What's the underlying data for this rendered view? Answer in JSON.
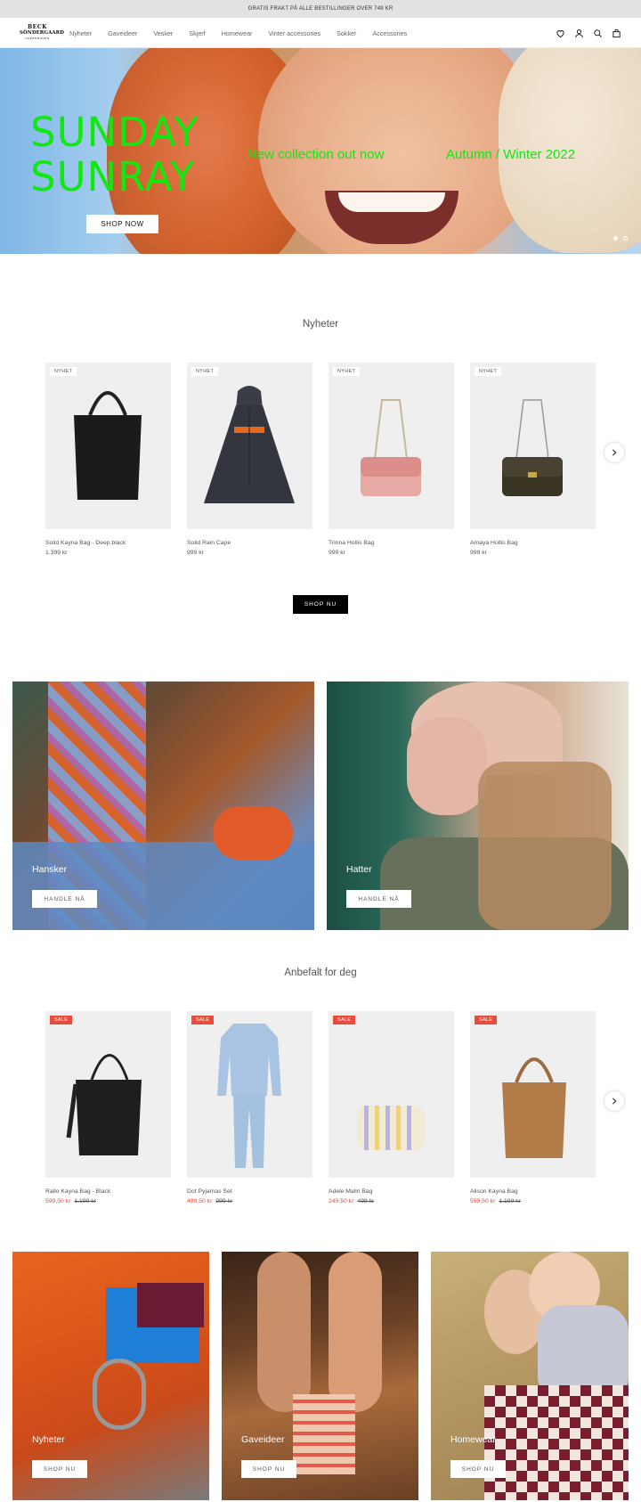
{
  "announcement": "GRATIS FRAKT PÅ ALLE BESTILLINGER OVER 749 KR",
  "logo": {
    "line1": "BECK",
    "line2": "SÖNDERGAARD",
    "line3": "COPENHAGEN"
  },
  "nav": [
    "Nyheter",
    "Gaveideer",
    "Vesker",
    "Skjerf",
    "Homewear",
    "Vinter accessories",
    "Sokker",
    "Accessories"
  ],
  "header_icons": [
    "heart-icon",
    "user-icon",
    "search-icon",
    "bag-icon"
  ],
  "hero": {
    "title_line1": "SUNDAY",
    "title_line2": "SUNRAY",
    "tagline1": "New collection out now",
    "tagline2": "Autumn / Winter 2022",
    "button": "SHOP NOW",
    "slide_count": 2,
    "active_slide": 1
  },
  "colors": {
    "accent_green": "#10e810",
    "sale_red": "#e74c3c"
  },
  "new_section": {
    "title": "Nyheter",
    "products": [
      {
        "badge": "NYHET",
        "name": "Solid Kayna Bag - Deep black",
        "price": "1.399 kr"
      },
      {
        "badge": "NYHET",
        "name": "Solid Rain Cape",
        "price": "999 kr"
      },
      {
        "badge": "NYHET",
        "name": "Trinna Hollis Bag",
        "price": "999 kr"
      },
      {
        "badge": "NYHET",
        "name": "Amaya Hollis Bag",
        "price": "999 kr"
      }
    ],
    "button": "SHOP NU"
  },
  "category_tiles": [
    {
      "label": "Hansker",
      "button": "HANDLE NÅ"
    },
    {
      "label": "Hatter",
      "button": "HANDLE NÅ"
    }
  ],
  "recommended_section": {
    "title": "Anbefalt for deg",
    "products": [
      {
        "badge": "SALE",
        "name": "Rallo Kayna Bag - Black",
        "sale_price": "599,50 kr",
        "old_price": "1.199 kr"
      },
      {
        "badge": "SALE",
        "name": "Dot Pyjamas Set",
        "sale_price": "499,50 kr",
        "old_price": "999 kr"
      },
      {
        "badge": "SALE",
        "name": "Adele Malin Bag",
        "sale_price": "249,50 kr",
        "old_price": "499 kr"
      },
      {
        "badge": "SALE",
        "name": "Alison Kayna Bag",
        "sale_price": "599,50 kr",
        "old_price": "1.199 kr"
      }
    ]
  },
  "bottom_tiles": [
    {
      "label": "Nyheter",
      "button": "SHOP NU"
    },
    {
      "label": "Gaveideer",
      "button": "SHOP NU"
    },
    {
      "label": "Homewear",
      "button": "SHOP NU"
    }
  ]
}
